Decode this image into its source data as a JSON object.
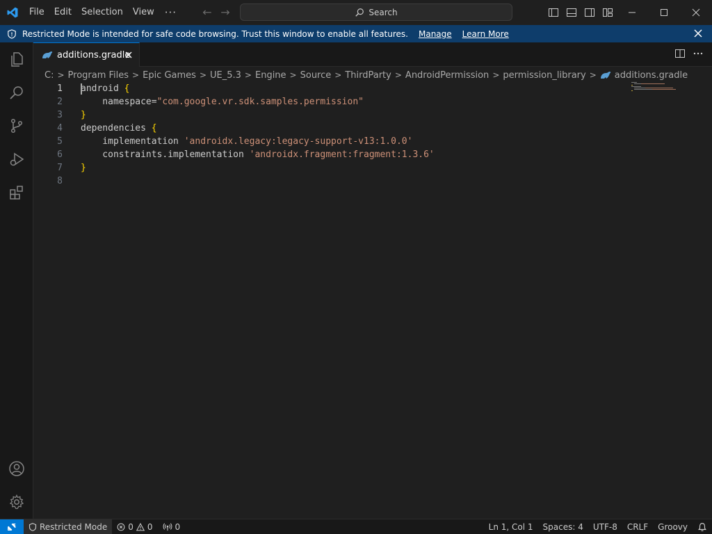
{
  "titlebar": {
    "menu": [
      "File",
      "Edit",
      "Selection",
      "View"
    ],
    "more": "···",
    "search": "Search"
  },
  "banner": {
    "text": "Restricted Mode is intended for safe code browsing. Trust this window to enable all features.",
    "manage": "Manage",
    "learn_more": "Learn More"
  },
  "tab": {
    "label": "additions.gradle"
  },
  "breadcrumb": [
    "C:",
    "Program Files",
    "Epic Games",
    "UE_5.3",
    "Engine",
    "Source",
    "ThirdParty",
    "AndroidPermission",
    "permission_library",
    "additions.gradle"
  ],
  "editor": {
    "lines": [
      {
        "num": "1",
        "tokens": [
          {
            "t": "android ",
            "c": ""
          },
          {
            "t": "{",
            "c": "brace"
          }
        ]
      },
      {
        "num": "2",
        "tokens": [
          {
            "t": "    namespace=",
            "c": ""
          },
          {
            "t": "\"com.google.vr.sdk.samples.permission\"",
            "c": "str"
          }
        ]
      },
      {
        "num": "3",
        "tokens": [
          {
            "t": "}",
            "c": "brace"
          }
        ]
      },
      {
        "num": "4",
        "tokens": [
          {
            "t": "dependencies ",
            "c": ""
          },
          {
            "t": "{",
            "c": "brace"
          }
        ]
      },
      {
        "num": "5",
        "tokens": [
          {
            "t": "    implementation ",
            "c": ""
          },
          {
            "t": "'androidx.legacy:legacy-support-v13:1.0.0'",
            "c": "str"
          }
        ]
      },
      {
        "num": "6",
        "tokens": [
          {
            "t": "    constraints.implementation ",
            "c": ""
          },
          {
            "t": "'androidx.fragment:fragment:1.3.6'",
            "c": "str"
          }
        ]
      },
      {
        "num": "7",
        "tokens": [
          {
            "t": "}",
            "c": "brace"
          }
        ]
      },
      {
        "num": "8",
        "tokens": []
      }
    ]
  },
  "statusbar": {
    "restricted": "Restricted Mode",
    "errors": "0",
    "warnings": "0",
    "ports": "0",
    "position": "Ln 1, Col 1",
    "spaces": "Spaces: 4",
    "encoding": "UTF-8",
    "eol": "CRLF",
    "language": "Groovy"
  },
  "colors": {
    "accent": "#0078d4",
    "banner": "#0e3d6b",
    "string": "#ce9178",
    "brace": "#ffd700"
  }
}
